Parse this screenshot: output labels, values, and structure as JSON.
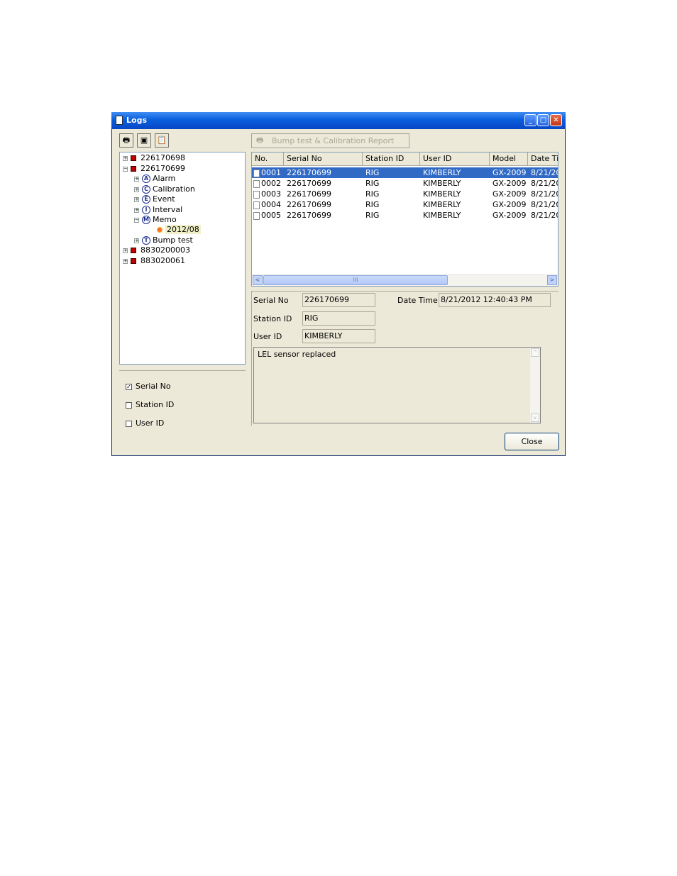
{
  "window": {
    "title": "Logs",
    "minimize_glyph": "_",
    "maximize_glyph": "□",
    "close_glyph": "✕"
  },
  "toolbar": {
    "print_icon": "printer-icon",
    "save_icon": "floppy-disk-icon",
    "clipboard_icon": "clipboard-icon",
    "print_glyph": "🖶",
    "save_glyph": "▣",
    "clipboard_glyph": "📋",
    "report_button_label": "Bump test & Calibration Report",
    "report_button_glyph": "🖶"
  },
  "tree": {
    "nodes": [
      {
        "label": "226170698",
        "exp": "+"
      },
      {
        "label": "226170699",
        "exp": "−"
      },
      {
        "label": "Alarm",
        "badge": "A",
        "exp": "+"
      },
      {
        "label": "Calibration",
        "badge": "C",
        "exp": "+"
      },
      {
        "label": "Event",
        "badge": "E",
        "exp": "+"
      },
      {
        "label": "Interval",
        "badge": "I",
        "exp": "+"
      },
      {
        "label": "Memo",
        "badge": "M",
        "exp": "−"
      },
      {
        "label": "2012/08"
      },
      {
        "label": "Bump test",
        "badge": "T",
        "exp": "+"
      },
      {
        "label": "8830200003",
        "exp": "+"
      },
      {
        "label": "883020061",
        "exp": "+"
      }
    ]
  },
  "filters": [
    {
      "label": "Serial No",
      "checked": true,
      "mark": "✓"
    },
    {
      "label": "Station ID",
      "checked": false,
      "mark": ""
    },
    {
      "label": "User ID",
      "checked": false,
      "mark": ""
    }
  ],
  "list": {
    "columns": [
      "No.",
      "Serial No",
      "Station ID",
      "User ID",
      "Model",
      "Date Ti"
    ],
    "rows": [
      [
        "0001",
        "226170699",
        "RIG",
        "KIMBERLY",
        "GX-2009",
        "8/21/20"
      ],
      [
        "0002",
        "226170699",
        "RIG",
        "KIMBERLY",
        "GX-2009",
        "8/21/20"
      ],
      [
        "0003",
        "226170699",
        "RIG",
        "KIMBERLY",
        "GX-2009",
        "8/21/20"
      ],
      [
        "0004",
        "226170699",
        "RIG",
        "KIMBERLY",
        "GX-2009",
        "8/21/20"
      ],
      [
        "0005",
        "226170699",
        "RIG",
        "KIMBERLY",
        "GX-2009",
        "8/21/20"
      ]
    ],
    "selected_row": 0,
    "scroll_left_glyph": "<",
    "scroll_right_glyph": ">",
    "scroll_thumb_glyph": "III"
  },
  "detail": {
    "serial_label": "Serial No",
    "serial_value": "226170699",
    "datetime_label": "Date Time",
    "datetime_value": "8/21/2012 12:40:43 PM",
    "station_label": "Station ID",
    "station_value": "RIG",
    "user_label": "User ID",
    "user_value": "KIMBERLY",
    "memo_text": "LEL sensor replaced",
    "memo_scroll_up_glyph": "^",
    "memo_scroll_down_glyph": "v"
  },
  "close_button_label": "Close",
  "colors": {
    "title_bar": "#0a5fdc",
    "selection": "#316ac5",
    "dialog_bg": "#ece9d8"
  }
}
